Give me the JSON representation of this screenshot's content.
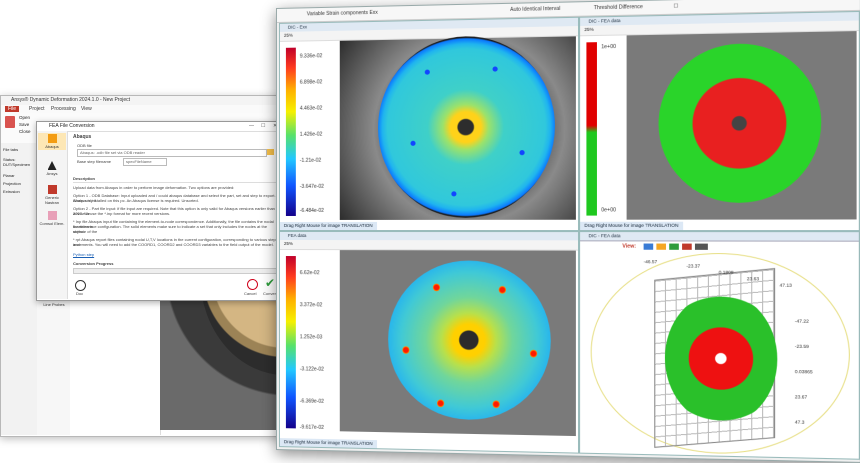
{
  "app": {
    "title": "Ansys® Dynamic Deformation 2024.1.0 - New Project",
    "menu_tabs": [
      "File",
      "Project",
      "Processing",
      "View"
    ],
    "ribbon_groups": [
      "Open",
      "Save",
      "Close"
    ],
    "left_labels": [
      "File tabs",
      "Status: DUT/Specimen",
      "Planar",
      "Projection",
      "Extrusion"
    ],
    "tools": [
      "Stat. Correlation",
      "Plot Deformation",
      "Strain Export",
      "Line Probes"
    ]
  },
  "dialog": {
    "title": "FEA File Conversion",
    "close_glyph": "✕",
    "options": [
      "Abaqus",
      "Ansys",
      "Generic Nastran",
      "Comsol Elem."
    ],
    "section_title": "Abaqus",
    "odb_label": "ODB file",
    "odb_value": "Abaqus: .odb file set via ODB reader",
    "base_label": "Base step filename",
    "base_value": "specFileName",
    "desc_heading": "Description",
    "desc_lines": [
      "Upload data from Abaqus in order to perform image deformation. Two options are provided:",
      "Option 1 - ODB Database: Input uploaded and / could abaqus database and select the part, set and step to export. Works only if",
      "Abaqus is installed on this pc. An Abaqus license is required. Unsorted.",
      "Option 2 - Part file input: if file input are required. Note that this option is only valid for Abaqus versions earlier than 2017. We",
      "advise to use the *.inp format for more recent versions.",
      "* Inp file Abaqus input file containing the element-to-node correspondence. Additionally, the file contains the nodal locations in",
      "the reference configuration. The solid elements make sure to indicate a set that only includes the nodes at the surface of the",
      "object.",
      "* rpt Abaqus report files containing nodal U,T,V locations in the current configuration, corresponding to various steps and",
      "increments. You will need to add the COORD1, COORD2 and COORD3 variables to the field output of the model."
    ],
    "link_text": "Python step",
    "progress_label": "Conversion Progress",
    "doc_label": "Doc",
    "cancel_label": "Cancel",
    "convert_label": "Convert"
  },
  "front": {
    "title_left": "Variable  Strain components Exx",
    "title_mid": "Auto Identical Interval",
    "title_right": "Threshold Difference",
    "panes": [
      {
        "title": "DIC - Exx",
        "zoom": "25%",
        "ticks": [
          "9.336e-02",
          "6.898e-02",
          "4.463e-02",
          "1.426e-02",
          "-1.21e-02",
          "-3.647e-02",
          "-6.484e-02"
        ],
        "footer": "Drag Right Mouse for image TRANSLATION"
      },
      {
        "title": "DIC - FEA data",
        "zoom": "25%",
        "ticks": [
          "1e+00",
          "0e+00"
        ],
        "footer": "Drag Right Mouse for image TRANSLATION"
      },
      {
        "title": "FEA data",
        "zoom": "25%",
        "ticks": [
          "6.62e-02",
          "3.372e-02",
          "1.252e-03",
          "-3.122e-02",
          "-6.369e-02",
          "-9.617e-02"
        ],
        "footer": "Drag Right Mouse for image TRANSLATION"
      },
      {
        "title": "DIC - FEA data",
        "view_label": "View:",
        "axis_top": [
          "-46.57",
          "-23.37",
          "0.1808",
          "23.63",
          "47.13"
        ],
        "axis_right": [
          "-47.22",
          "-23.59",
          "0.03865",
          "23.67",
          "47.3"
        ]
      }
    ]
  },
  "colors": {
    "accent": "#f5a623",
    "pane_header": "#dfe9f3",
    "footer": "#dce8f5",
    "cancel_red": "#d0021b",
    "convert_green": "#2e9c3c"
  }
}
